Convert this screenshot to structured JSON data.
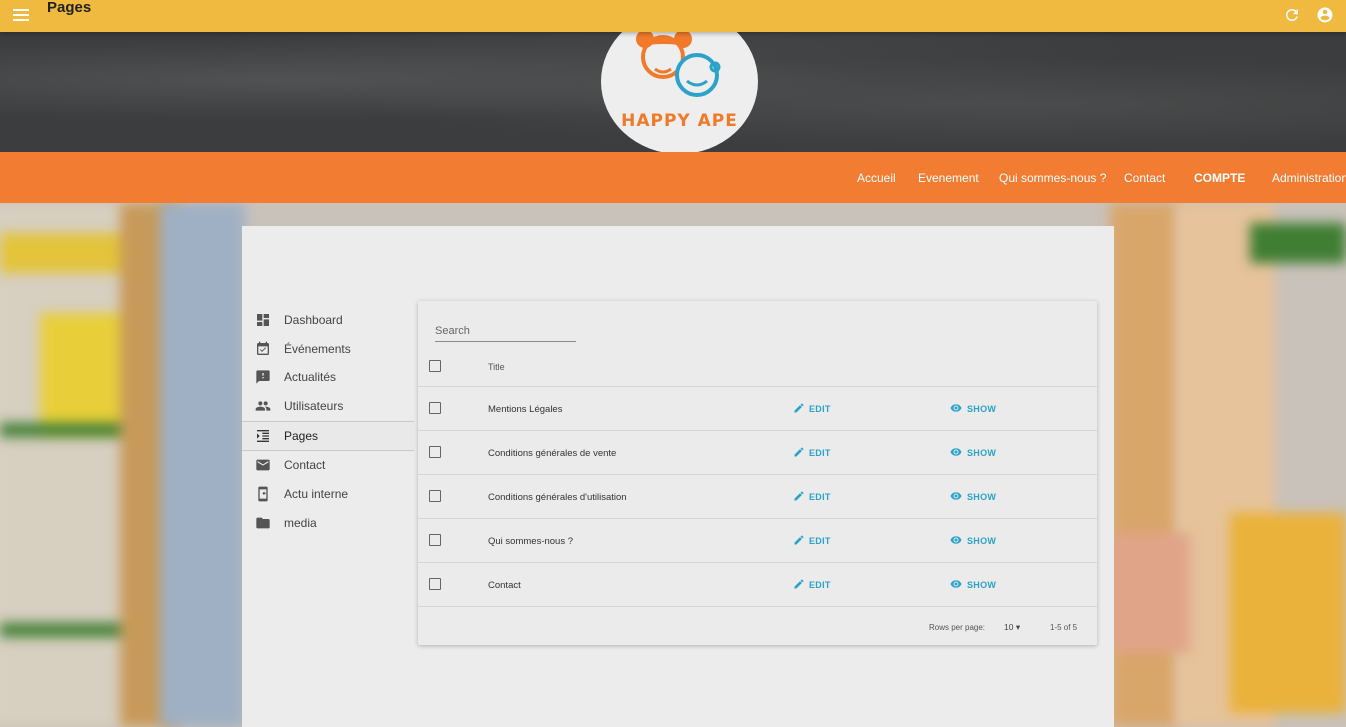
{
  "appbar": {
    "title": "Pages",
    "menu_icon": "menu-icon",
    "refresh_icon": "refresh-icon",
    "account_icon": "account-circle-icon"
  },
  "brand": {
    "logo_text": "HAPPY APE",
    "accent": "#f27c32",
    "bar": "#f0b93f",
    "link": "#2aa2c9"
  },
  "nav": {
    "items": [
      "Accueil",
      "Evenement",
      "Qui sommes-nous ?",
      "Contact",
      "COMPTE",
      "Administration"
    ]
  },
  "sidebar": {
    "items": [
      {
        "label": "Dashboard",
        "icon": "dashboard-icon"
      },
      {
        "label": "Événements",
        "icon": "event-icon"
      },
      {
        "label": "Actualités",
        "icon": "feedback-icon"
      },
      {
        "label": "Utilisateurs",
        "icon": "people-icon"
      },
      {
        "label": "Pages",
        "icon": "list-icon",
        "active": true
      },
      {
        "label": "Contact",
        "icon": "mail-icon"
      },
      {
        "label": "Actu interne",
        "icon": "phone-icon"
      },
      {
        "label": "media",
        "icon": "folder-icon"
      }
    ]
  },
  "list": {
    "search_placeholder": "Search",
    "column_title": "Title",
    "edit_label": "EDIT",
    "show_label": "SHOW",
    "rows": [
      {
        "title": "Mentions Légales"
      },
      {
        "title": "Conditions générales de vente"
      },
      {
        "title": "Conditions générales d'utilisation"
      },
      {
        "title": "Qui sommes-nous ?"
      },
      {
        "title": "Contact"
      }
    ],
    "rows_per_page_label": "Rows per page:",
    "rows_per_page_value": "10",
    "range": "1-5 of 5"
  }
}
